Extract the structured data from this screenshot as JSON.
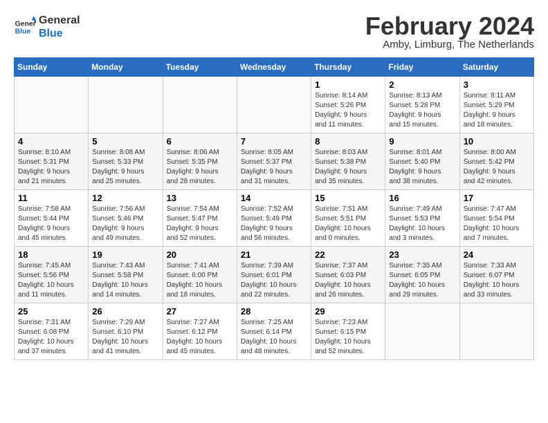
{
  "logo": {
    "line1": "General",
    "line2": "Blue"
  },
  "title": "February 2024",
  "location": "Amby, Limburg, The Netherlands",
  "weekdays": [
    "Sunday",
    "Monday",
    "Tuesday",
    "Wednesday",
    "Thursday",
    "Friday",
    "Saturday"
  ],
  "weeks": [
    [
      {
        "day": "",
        "info": ""
      },
      {
        "day": "",
        "info": ""
      },
      {
        "day": "",
        "info": ""
      },
      {
        "day": "",
        "info": ""
      },
      {
        "day": "1",
        "info": "Sunrise: 8:14 AM\nSunset: 5:26 PM\nDaylight: 9 hours\nand 11 minutes."
      },
      {
        "day": "2",
        "info": "Sunrise: 8:13 AM\nSunset: 5:28 PM\nDaylight: 9 hours\nand 15 minutes."
      },
      {
        "day": "3",
        "info": "Sunrise: 8:11 AM\nSunset: 5:29 PM\nDaylight: 9 hours\nand 18 minutes."
      }
    ],
    [
      {
        "day": "4",
        "info": "Sunrise: 8:10 AM\nSunset: 5:31 PM\nDaylight: 9 hours\nand 21 minutes."
      },
      {
        "day": "5",
        "info": "Sunrise: 8:08 AM\nSunset: 5:33 PM\nDaylight: 9 hours\nand 25 minutes."
      },
      {
        "day": "6",
        "info": "Sunrise: 8:06 AM\nSunset: 5:35 PM\nDaylight: 9 hours\nand 28 minutes."
      },
      {
        "day": "7",
        "info": "Sunrise: 8:05 AM\nSunset: 5:37 PM\nDaylight: 9 hours\nand 31 minutes."
      },
      {
        "day": "8",
        "info": "Sunrise: 8:03 AM\nSunset: 5:38 PM\nDaylight: 9 hours\nand 35 minutes."
      },
      {
        "day": "9",
        "info": "Sunrise: 8:01 AM\nSunset: 5:40 PM\nDaylight: 9 hours\nand 38 minutes."
      },
      {
        "day": "10",
        "info": "Sunrise: 8:00 AM\nSunset: 5:42 PM\nDaylight: 9 hours\nand 42 minutes."
      }
    ],
    [
      {
        "day": "11",
        "info": "Sunrise: 7:58 AM\nSunset: 5:44 PM\nDaylight: 9 hours\nand 45 minutes."
      },
      {
        "day": "12",
        "info": "Sunrise: 7:56 AM\nSunset: 5:46 PM\nDaylight: 9 hours\nand 49 minutes."
      },
      {
        "day": "13",
        "info": "Sunrise: 7:54 AM\nSunset: 5:47 PM\nDaylight: 9 hours\nand 52 minutes."
      },
      {
        "day": "14",
        "info": "Sunrise: 7:52 AM\nSunset: 5:49 PM\nDaylight: 9 hours\nand 56 minutes."
      },
      {
        "day": "15",
        "info": "Sunrise: 7:51 AM\nSunset: 5:51 PM\nDaylight: 10 hours\nand 0 minutes."
      },
      {
        "day": "16",
        "info": "Sunrise: 7:49 AM\nSunset: 5:53 PM\nDaylight: 10 hours\nand 3 minutes."
      },
      {
        "day": "17",
        "info": "Sunrise: 7:47 AM\nSunset: 5:54 PM\nDaylight: 10 hours\nand 7 minutes."
      }
    ],
    [
      {
        "day": "18",
        "info": "Sunrise: 7:45 AM\nSunset: 5:56 PM\nDaylight: 10 hours\nand 11 minutes."
      },
      {
        "day": "19",
        "info": "Sunrise: 7:43 AM\nSunset: 5:58 PM\nDaylight: 10 hours\nand 14 minutes."
      },
      {
        "day": "20",
        "info": "Sunrise: 7:41 AM\nSunset: 6:00 PM\nDaylight: 10 hours\nand 18 minutes."
      },
      {
        "day": "21",
        "info": "Sunrise: 7:39 AM\nSunset: 6:01 PM\nDaylight: 10 hours\nand 22 minutes."
      },
      {
        "day": "22",
        "info": "Sunrise: 7:37 AM\nSunset: 6:03 PM\nDaylight: 10 hours\nand 26 minutes."
      },
      {
        "day": "23",
        "info": "Sunrise: 7:35 AM\nSunset: 6:05 PM\nDaylight: 10 hours\nand 29 minutes."
      },
      {
        "day": "24",
        "info": "Sunrise: 7:33 AM\nSunset: 6:07 PM\nDaylight: 10 hours\nand 33 minutes."
      }
    ],
    [
      {
        "day": "25",
        "info": "Sunrise: 7:31 AM\nSunset: 6:08 PM\nDaylight: 10 hours\nand 37 minutes."
      },
      {
        "day": "26",
        "info": "Sunrise: 7:29 AM\nSunset: 6:10 PM\nDaylight: 10 hours\nand 41 minutes."
      },
      {
        "day": "27",
        "info": "Sunrise: 7:27 AM\nSunset: 6:12 PM\nDaylight: 10 hours\nand 45 minutes."
      },
      {
        "day": "28",
        "info": "Sunrise: 7:25 AM\nSunset: 6:14 PM\nDaylight: 10 hours\nand 48 minutes."
      },
      {
        "day": "29",
        "info": "Sunrise: 7:23 AM\nSunset: 6:15 PM\nDaylight: 10 hours\nand 52 minutes."
      },
      {
        "day": "",
        "info": ""
      },
      {
        "day": "",
        "info": ""
      }
    ]
  ]
}
